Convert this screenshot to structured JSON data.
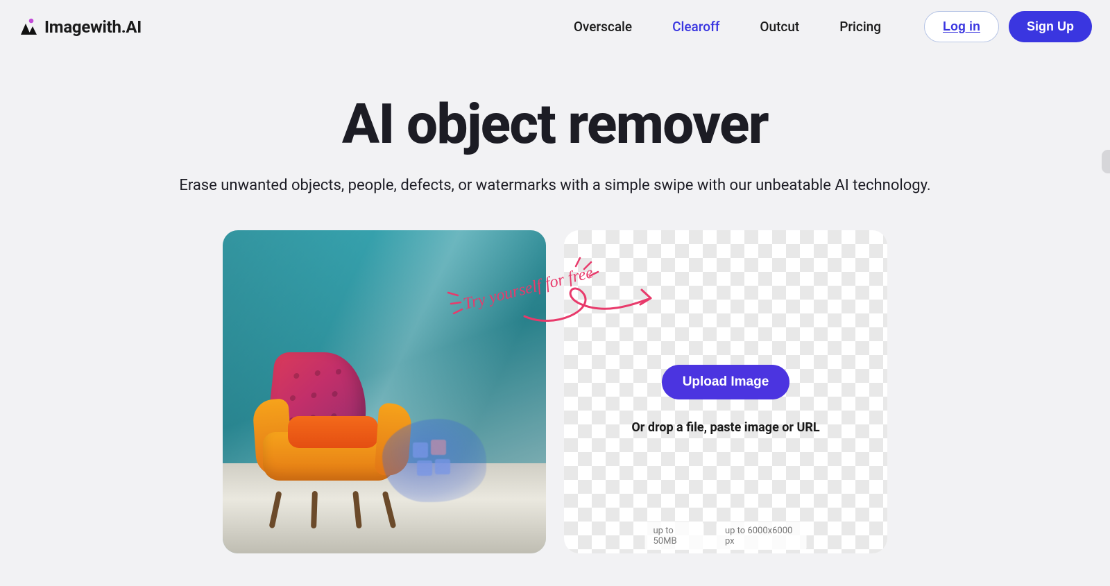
{
  "brand": {
    "name": "Imagewith.AI"
  },
  "nav": {
    "items": [
      {
        "label": "Overscale",
        "active": false
      },
      {
        "label": "Clearoff",
        "active": true
      },
      {
        "label": "Outcut",
        "active": false
      },
      {
        "label": "Pricing",
        "active": false
      }
    ]
  },
  "auth": {
    "login": "Log in",
    "signup": "Sign Up"
  },
  "hero": {
    "title": "AI object remover",
    "subtitle": "Erase unwanted objects, people, defects, or watermarks with a simple swipe with our unbeatable AI technology."
  },
  "callout": {
    "text": "Try yourself for free"
  },
  "upload": {
    "button": "Upload Image",
    "drop_text": "Or drop a file, paste image or URL",
    "limit_size": "up to 50MB",
    "limit_dims": "up to 6000x6000 px"
  }
}
